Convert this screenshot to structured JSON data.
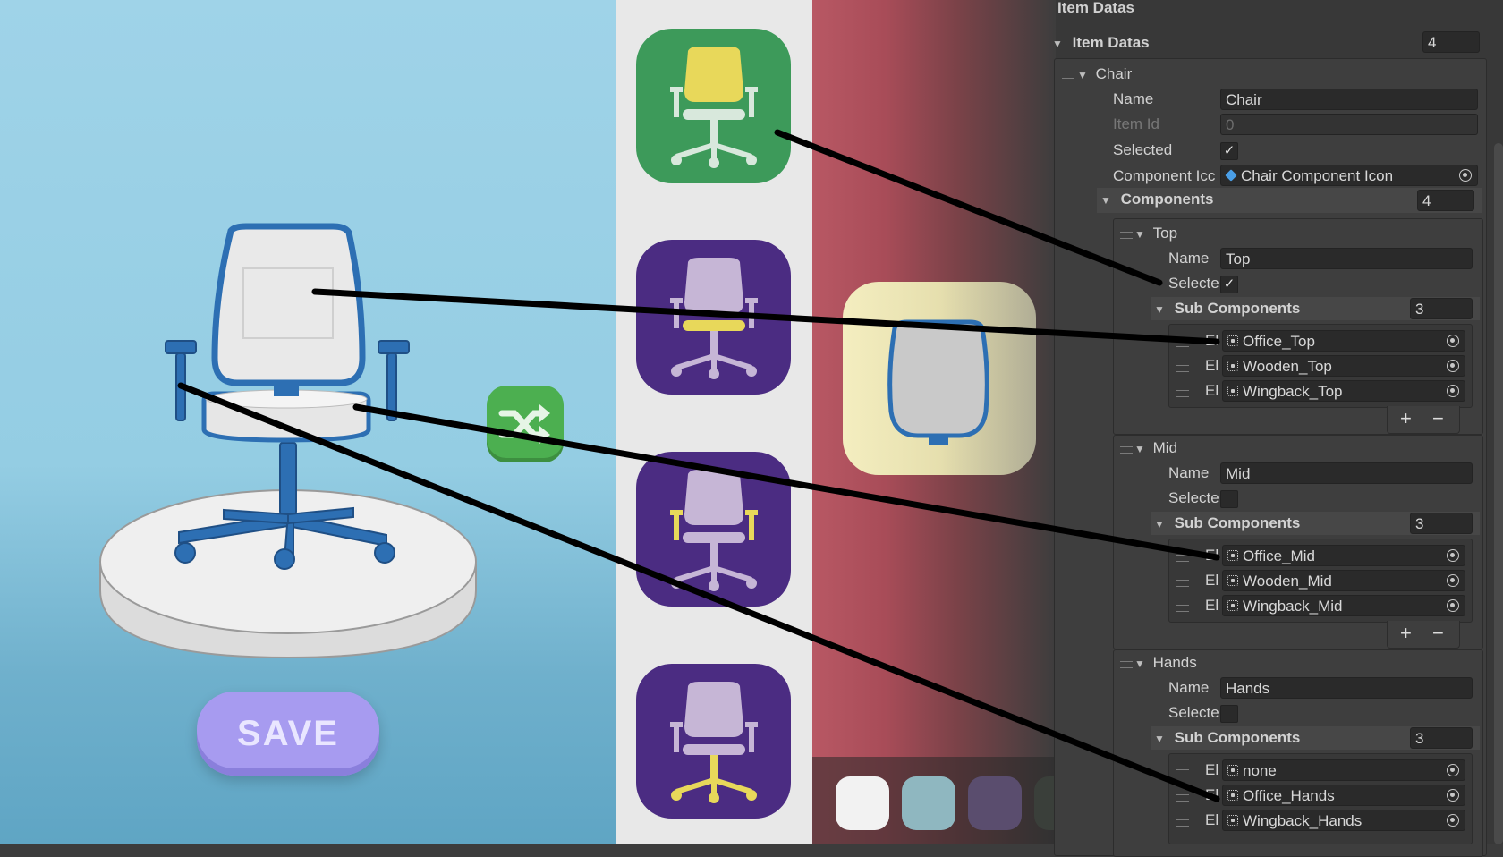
{
  "stage": {
    "save_label": "SAVE"
  },
  "category_buttons": [
    {
      "name": "top",
      "state": "active",
      "highlight": "#e8d85a"
    },
    {
      "name": "mid",
      "state": "inactive",
      "highlight": "#e8d85a"
    },
    {
      "name": "hands",
      "state": "inactive",
      "highlight": "#e8d85a"
    },
    {
      "name": "legs",
      "state": "inactive",
      "highlight": "#e8d85a"
    }
  ],
  "swatches": [
    "#f2f2f2",
    "#8fb7c0",
    "#5a4d6e",
    "#3a3f3a"
  ],
  "colors": {
    "active_category": "#3d9a5a",
    "inactive_category": "#4b2c82",
    "save_button": "#a79bf0",
    "shuffle_button": "#4caf50"
  },
  "inspector": {
    "header": "Item Datas",
    "list": {
      "label": "Item Datas",
      "size": "4"
    },
    "item": {
      "label": "Chair",
      "name_label": "Name",
      "name_value": "Chair",
      "id_label": "Item Id",
      "id_value": "0",
      "selected_label": "Selected",
      "selected_mark": "✓",
      "icon_label": "Component Icc",
      "icon_value": "Chair Component Icon",
      "components_label": "Components",
      "components_size": "4"
    },
    "components": [
      {
        "label": "Top",
        "name_label": "Name",
        "name_value": "Top",
        "selected_label": "Selecte",
        "selected_mark": "✓",
        "sub_label": "Sub Components",
        "sub_size": "3",
        "elements": [
          {
            "prefix": "El",
            "value": "Office_Top"
          },
          {
            "prefix": "El",
            "value": "Wooden_Top"
          },
          {
            "prefix": "El",
            "value": "Wingback_Top"
          }
        ]
      },
      {
        "label": "Mid",
        "name_label": "Name",
        "name_value": "Mid",
        "selected_label": "Selecte",
        "selected_mark": "",
        "sub_label": "Sub Components",
        "sub_size": "3",
        "elements": [
          {
            "prefix": "El",
            "value": "Office_Mid"
          },
          {
            "prefix": "El",
            "value": "Wooden_Mid"
          },
          {
            "prefix": "El",
            "value": "Wingback_Mid"
          }
        ]
      },
      {
        "label": "Hands",
        "name_label": "Name",
        "name_value": "Hands",
        "selected_label": "Selecte",
        "selected_mark": "",
        "sub_label": "Sub Components",
        "sub_size": "3",
        "elements": [
          {
            "prefix": "El",
            "value": "none"
          },
          {
            "prefix": "El",
            "value": "Office_Hands"
          },
          {
            "prefix": "El",
            "value": "Wingback_Hands"
          }
        ]
      }
    ],
    "plus": "+",
    "minus": "−"
  }
}
